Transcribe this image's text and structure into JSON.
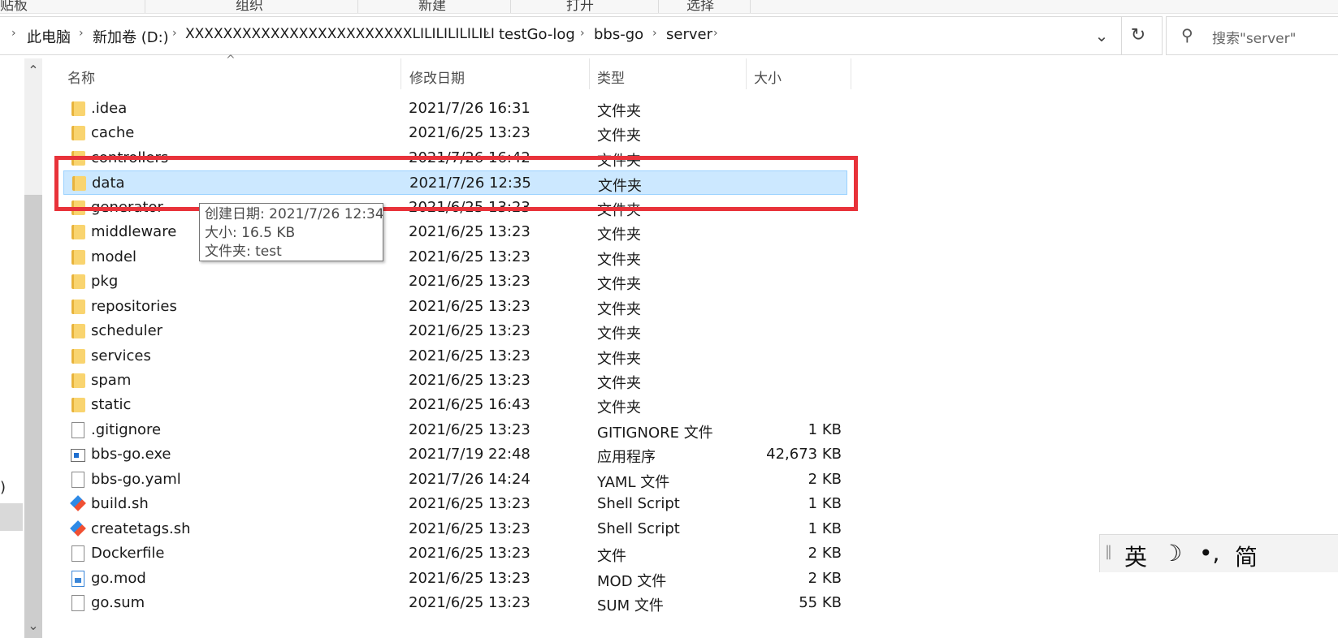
{
  "ribbon": {
    "labels": [
      "贴板",
      "组织",
      "新建",
      "打开",
      "选择"
    ]
  },
  "address": {
    "crumbs": [
      "此电脑",
      "新加卷 (D:)",
      "XXXXXXXXXXXXXXXXXXXXXXXXLILILILILILILI",
      "testGo-log",
      "bbs-go",
      "server"
    ],
    "dropdown_icon": "chevron-down-icon",
    "refresh_icon": "refresh-icon"
  },
  "search": {
    "placeholder": "搜索\"server\"",
    "icon": "search-icon"
  },
  "columns": {
    "name": "名称",
    "modified": "修改日期",
    "type": "类型",
    "size": "大小"
  },
  "files": [
    {
      "name": ".idea",
      "modified": "2021/7/26 16:31",
      "type": "文件夹",
      "size": "",
      "icon": "folder"
    },
    {
      "name": "cache",
      "modified": "2021/6/25 13:23",
      "type": "文件夹",
      "size": "",
      "icon": "folder"
    },
    {
      "name": "controllers",
      "modified": "2021/7/26 16:42",
      "type": "文件夹",
      "size": "",
      "icon": "folder"
    },
    {
      "name": "data",
      "modified": "2021/7/26 12:35",
      "type": "文件夹",
      "size": "",
      "icon": "folder",
      "selected": true
    },
    {
      "name": "generator",
      "modified": "2021/6/25 13:23",
      "type": "文件夹",
      "size": "",
      "icon": "folder"
    },
    {
      "name": "middleware",
      "modified": "2021/6/25 13:23",
      "type": "文件夹",
      "size": "",
      "icon": "folder"
    },
    {
      "name": "model",
      "modified": "2021/6/25 13:23",
      "type": "文件夹",
      "size": "",
      "icon": "folder"
    },
    {
      "name": "pkg",
      "modified": "2021/6/25 13:23",
      "type": "文件夹",
      "size": "",
      "icon": "folder"
    },
    {
      "name": "repositories",
      "modified": "2021/6/25 13:23",
      "type": "文件夹",
      "size": "",
      "icon": "folder"
    },
    {
      "name": "scheduler",
      "modified": "2021/6/25 13:23",
      "type": "文件夹",
      "size": "",
      "icon": "folder"
    },
    {
      "name": "services",
      "modified": "2021/6/25 13:23",
      "type": "文件夹",
      "size": "",
      "icon": "folder"
    },
    {
      "name": "spam",
      "modified": "2021/6/25 13:23",
      "type": "文件夹",
      "size": "",
      "icon": "folder"
    },
    {
      "name": "static",
      "modified": "2021/6/25 16:43",
      "type": "文件夹",
      "size": "",
      "icon": "folder"
    },
    {
      "name": ".gitignore",
      "modified": "2021/6/25 13:23",
      "type": "GITIGNORE 文件",
      "size": "1 KB",
      "icon": "file"
    },
    {
      "name": "bbs-go.exe",
      "modified": "2021/7/19 22:48",
      "type": "应用程序",
      "size": "42,673 KB",
      "icon": "exe"
    },
    {
      "name": "bbs-go.yaml",
      "modified": "2021/7/26 14:24",
      "type": "YAML 文件",
      "size": "2 KB",
      "icon": "file"
    },
    {
      "name": "build.sh",
      "modified": "2021/6/25 13:23",
      "type": "Shell Script",
      "size": "1 KB",
      "icon": "git"
    },
    {
      "name": "createtags.sh",
      "modified": "2021/6/25 13:23",
      "type": "Shell Script",
      "size": "1 KB",
      "icon": "git"
    },
    {
      "name": "Dockerfile",
      "modified": "2021/6/25 13:23",
      "type": "文件",
      "size": "2 KB",
      "icon": "file"
    },
    {
      "name": "go.mod",
      "modified": "2021/6/25 13:23",
      "type": "MOD 文件",
      "size": "2 KB",
      "icon": "mod"
    },
    {
      "name": "go.sum",
      "modified": "2021/6/25 13:23",
      "type": "SUM 文件",
      "size": "55 KB",
      "icon": "file"
    }
  ],
  "tooltip": {
    "line1": "创建日期: 2021/7/26 12:34",
    "line2": "大小: 16.5 KB",
    "line3": "文件夹: test"
  },
  "ime": {
    "grip": "‖",
    "lang": "英",
    "moon": "☽",
    "punct": "•,",
    "mode": "简"
  },
  "nav": {
    "left_glyph": ")"
  },
  "colors": {
    "selection_bg": "#cce8ff",
    "highlight_border": "#e8323a",
    "folder": "#f9d46f"
  }
}
